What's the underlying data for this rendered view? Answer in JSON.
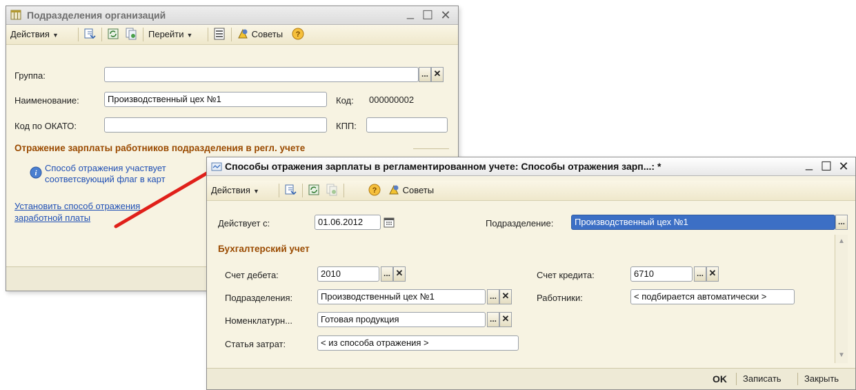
{
  "win1": {
    "title": "Подразделения организаций",
    "toolbar": {
      "actions": "Действия",
      "goto": "Перейти",
      "tips": "Советы"
    },
    "fields": {
      "group_label": "Группа:",
      "group_value": "",
      "name_label": "Наименование:",
      "name_value": "Производственный цех №1",
      "code_label": "Код:",
      "code_value": "000000002",
      "okato_label": "Код по ОКАТО:",
      "okato_value": "",
      "kpp_label": "КПП:",
      "kpp_value": ""
    },
    "section_title": "Отражение зарплаты работников подразделения  в регл. учете",
    "info_line1": "Способ отражения участвует",
    "info_line2": "соответсвующий флаг в карт",
    "link_line1": "Установить способ отражения",
    "link_line2": "заработной платы"
  },
  "win2": {
    "title": "Способы отражения зарплаты в регламентированном учете: Способы отражения зарп...: *",
    "toolbar": {
      "actions": "Действия",
      "tips": "Советы"
    },
    "valid_from_label": "Действует с:",
    "valid_from_value": "01.06.2012",
    "department_label": "Подразделение:",
    "department_value": "Производственный цех №1",
    "section_title": "Бухгалтерский учет",
    "debit_label": "Счет дебета:",
    "debit_value": "2010",
    "credit_label": "Счет кредита:",
    "credit_value": "6710",
    "departments_label": "Подразделения:",
    "departments_value": "Производственный цех №1",
    "employees_label": "Работники:",
    "employees_value": "< подбирается автоматически >",
    "nomenclature_label": "Номенклатурн...",
    "nomenclature_value": "Готовая продукция",
    "cost_item_label": "Статья затрат:",
    "cost_item_value": "< из способа отражения >",
    "buttons": {
      "ok": "OK",
      "save": "Записать",
      "close": "Закрыть"
    }
  },
  "icons": {
    "ellipsis": "...",
    "clear": "✕",
    "minimize": "_",
    "maximize": "☐",
    "close": "✕",
    "dropdown": "▼",
    "info": "i",
    "help": "?",
    "scroll_up": "▲",
    "scroll_down": "▼"
  },
  "colors": {
    "accent_section": "#9a4a00",
    "link": "#1f4fb5",
    "selection": "#3c6fc5",
    "annotation_arrow": "#e0201a"
  }
}
